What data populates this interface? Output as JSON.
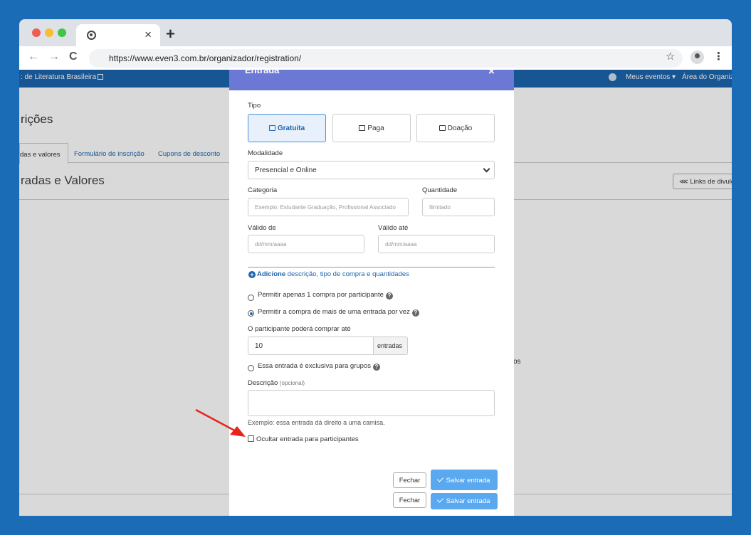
{
  "browser": {
    "url": "https://www.even3.com.br/organizador/registration/",
    "tab_close": "×",
    "new_tab": "+",
    "back": "←",
    "forward": "→",
    "reload": "C",
    "star": "☆",
    "menu": "⋮"
  },
  "topnav": {
    "event_name": ": de Literatura Brasileira",
    "meus_eventos": "Meus eventos ▾",
    "area": "Área do Organiza"
  },
  "page": {
    "title": "rições",
    "tabs": [
      {
        "label": "das e valores"
      },
      {
        "label": "Formulário de inscrição"
      },
      {
        "label": "Cupons de desconto"
      }
    ],
    "section_title": "radas e Valores",
    "links_button": "Links de divulg",
    "links_icon": "share-icon",
    "obscured_text": "os"
  },
  "modal": {
    "title": "Entrada",
    "close": "×",
    "tipo_label": "Tipo",
    "types": [
      {
        "label": "Gratuita",
        "selected": true
      },
      {
        "label": "Paga",
        "selected": false
      },
      {
        "label": "Doação",
        "selected": false
      }
    ],
    "modalidade_label": "Modalidade",
    "modalidade_value": "Presencial e Online",
    "categoria_label": "Categoria",
    "categoria_placeholder": "Exemplo: Estudante Graduação, Profissional Associado",
    "quantidade_label": "Quantidade",
    "quantidade_placeholder": "Ilimitado",
    "valido_de_label": "Válido de",
    "valido_de_placeholder": "dd/mm/aaaa",
    "valido_ate_label": "Válido até",
    "valido_ate_placeholder": "dd/mm/aaaa",
    "add_link_bold": "Adicione",
    "add_link_rest": " descrição, tipo de compra e quantidades",
    "radio_one": "Permitir apenas 1 compra por participante",
    "radio_many": "Permitir a compra de mais de uma entrada por vez",
    "qty_label": "O participante poderá comprar até",
    "qty_value": "10",
    "qty_addon": "entradas",
    "radio_groups": "Essa entrada é exclusiva para grupos",
    "help": "?",
    "descricao_label": "Descrição",
    "descricao_optional": "(opcional)",
    "descricao_hint": "Exemplo: essa entrada dá direito a uma camisa.",
    "hide_label": "Ocultar entrada para participantes",
    "fechar": "Fechar",
    "salvar": "Salvar entrada"
  },
  "colors": {
    "background": "#1b6cb7",
    "header": "#6c79d4",
    "primary": "#1d65ad",
    "save_button": "#5aa9f0",
    "arrow": "#e8241c"
  }
}
